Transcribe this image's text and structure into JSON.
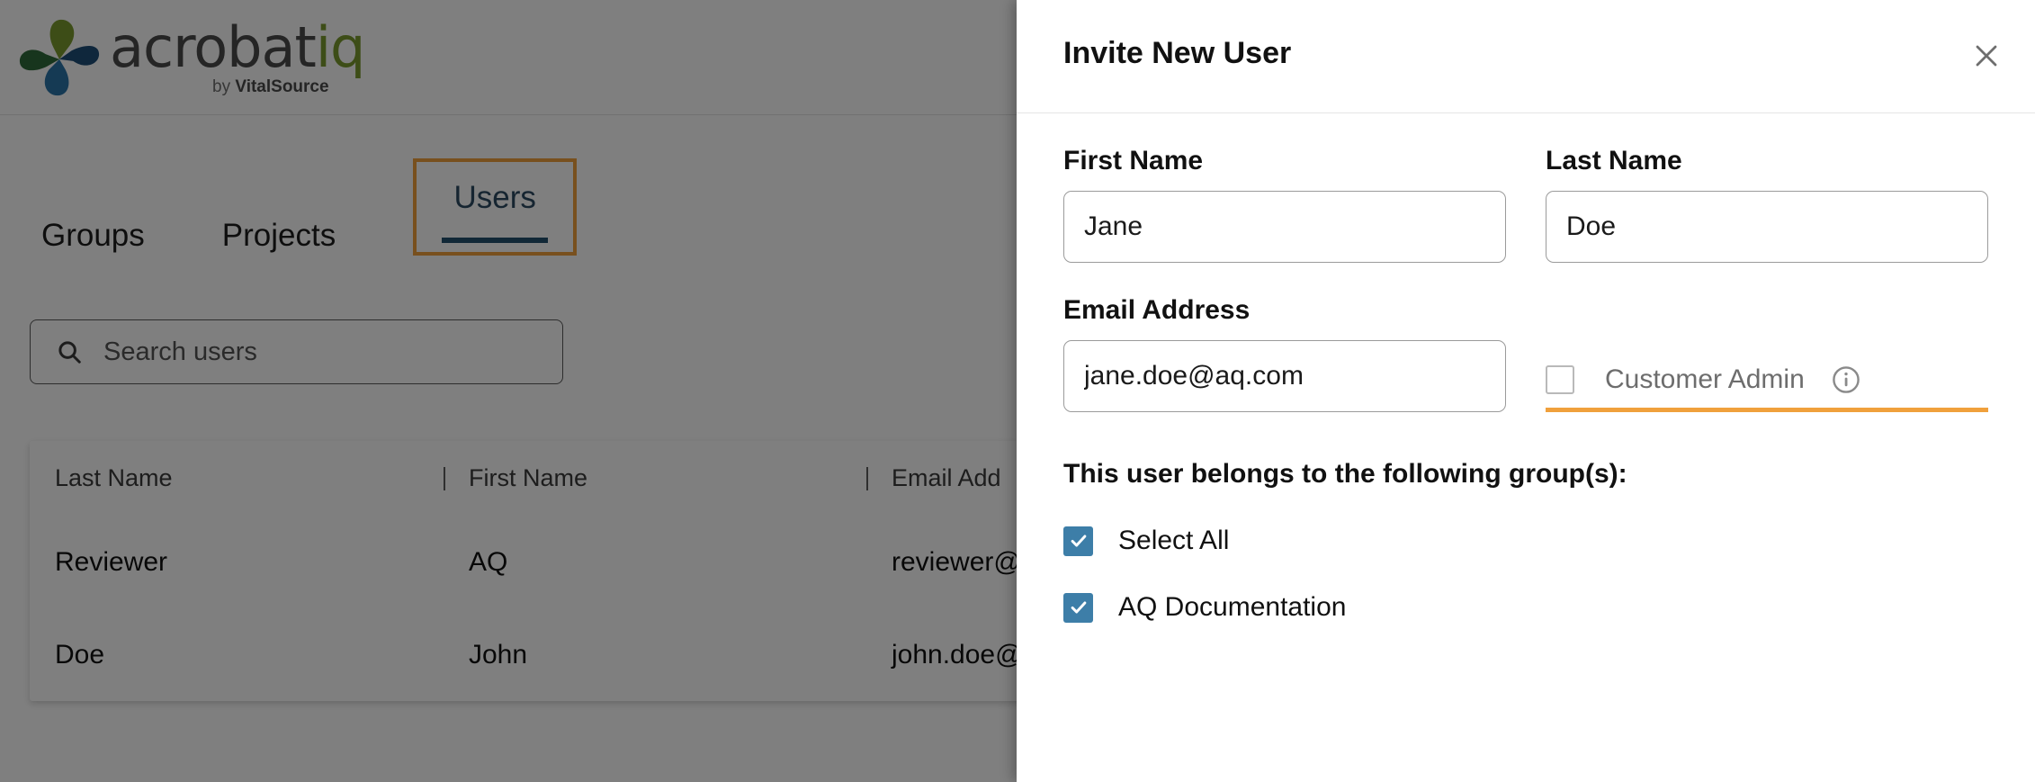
{
  "brand": {
    "logo_text": "acrobat",
    "logo_text_accent": "iq",
    "logo_sub_prefix": "by ",
    "logo_sub_name": "VitalSource",
    "colors": {
      "accent_orange": "#f0a03c",
      "tab_navy": "#2c4a63",
      "checkbox_blue": "#3d7ea8",
      "logo_green": "#7a9a2e",
      "logo_dark_green": "#2e6b3a",
      "logo_blue": "#1f4e79",
      "overlay_gray": "#808080"
    }
  },
  "tabs": [
    {
      "label": "Groups",
      "active": false
    },
    {
      "label": "Projects",
      "active": false
    },
    {
      "label": "Users",
      "active": true
    }
  ],
  "search": {
    "placeholder": "Search users",
    "icon": "search-icon"
  },
  "table": {
    "columns": [
      "Last Name",
      "First Name",
      "Email Add"
    ],
    "rows": [
      {
        "last_name": "Reviewer",
        "first_name": "AQ",
        "email": "reviewer@"
      },
      {
        "last_name": "Doe",
        "first_name": "John",
        "email": "john.doe@"
      }
    ]
  },
  "drawer": {
    "title": "Invite New User",
    "close_icon": "close-icon",
    "fields": {
      "first_name": {
        "label": "First Name",
        "value": "Jane",
        "placeholder": "First Name"
      },
      "last_name": {
        "label": "Last Name",
        "value": "Doe",
        "placeholder": "Last Name"
      },
      "email": {
        "label": "Email Address",
        "value": "jane.doe@aq.com",
        "placeholder": "Email Address"
      }
    },
    "customer_admin": {
      "label": "Customer Admin",
      "checked": false,
      "info_icon": "info-icon"
    },
    "groups_section": {
      "title": "This user belongs to the following group(s):",
      "items": [
        {
          "label": "Select All",
          "checked": true
        },
        {
          "label": "AQ Documentation",
          "checked": true
        }
      ]
    }
  }
}
